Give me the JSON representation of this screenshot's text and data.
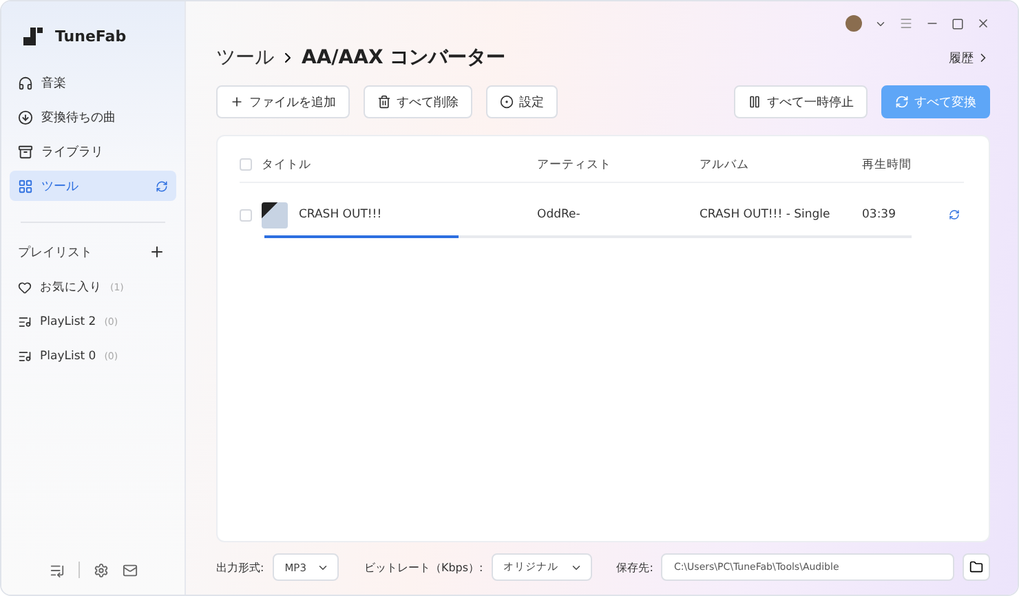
{
  "app": {
    "name": "TuneFab"
  },
  "sidebar": {
    "items": [
      {
        "kind": "music",
        "label": "音楽",
        "selected": false
      },
      {
        "kind": "download",
        "label": "変換待ちの曲",
        "selected": false
      },
      {
        "kind": "library",
        "label": "ライブラリ",
        "selected": false
      },
      {
        "kind": "tools",
        "label": "ツール",
        "selected": true
      }
    ],
    "playlists_title": "プレイリスト",
    "playlists": [
      {
        "kind": "favorite",
        "label": "お気に入り",
        "count": "(1)"
      },
      {
        "kind": "playlist",
        "label": "PlayList 2",
        "count": "(0)"
      },
      {
        "kind": "playlist",
        "label": "PlayList 0",
        "count": "(0)"
      }
    ]
  },
  "breadcrumb": {
    "parent": "ツール",
    "current": "AA/AAX コンバーター"
  },
  "history_link": "履歴",
  "toolbar": [
    {
      "kind": "add",
      "label": "ファイルを追加"
    },
    {
      "kind": "delete",
      "label": "すべて削除"
    },
    {
      "kind": "settings",
      "label": "設定"
    }
  ],
  "actions": [
    {
      "kind": "pause",
      "label": "すべて一時停止",
      "primary": false
    },
    {
      "kind": "convert",
      "label": "すべて変換",
      "primary": true
    }
  ],
  "table": {
    "select_all_checked": false,
    "columns": [
      "タイトル",
      "アーティスト",
      "アルバム",
      "再生時間"
    ],
    "rows": [
      {
        "title": "CRASH OUT!!!",
        "artist": "OddRe-",
        "album": "CRASH OUT!!! - Single",
        "duration": "03:39",
        "checked": false,
        "level": 0.3
      }
    ]
  },
  "footer": {
    "format_label": "出力形式:",
    "format": "MP3",
    "bitrate_label": "ビットレート（Kbps）:",
    "bitrate": "オリジナル",
    "save_label": "保存先:",
    "save_path": "C:\\Users\\PC\\TuneFab\\Tools\\Audible"
  }
}
